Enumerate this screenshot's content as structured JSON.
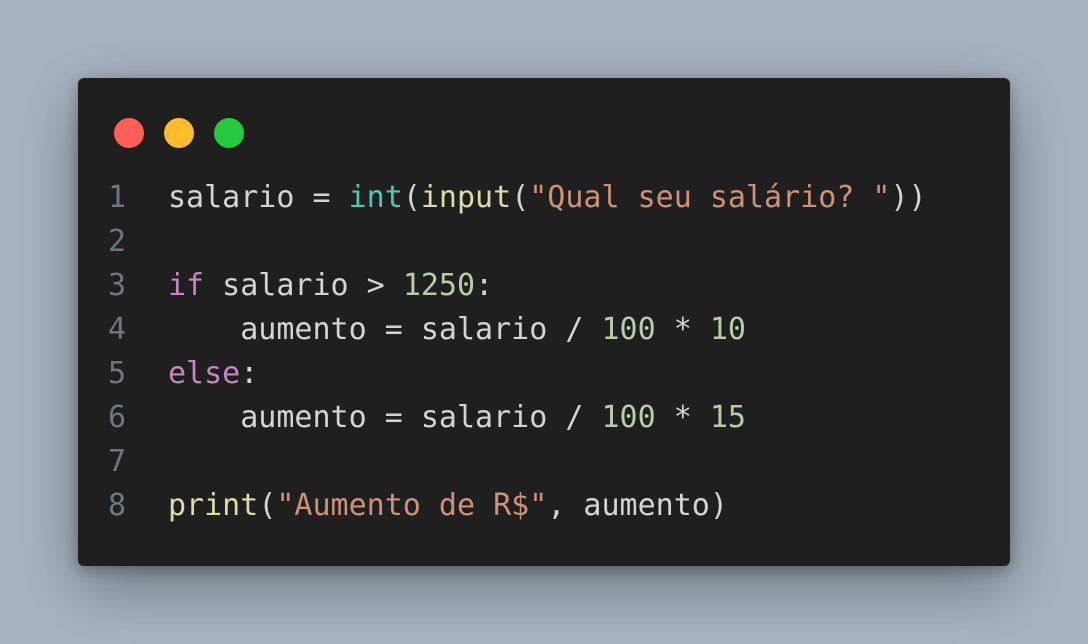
{
  "window": {
    "dots": [
      {
        "name": "close",
        "color": "#ff5f56"
      },
      {
        "name": "minimize",
        "color": "#ffbd2e"
      },
      {
        "name": "maximize",
        "color": "#27c93f"
      }
    ]
  },
  "code": {
    "lines": [
      {
        "n": "1",
        "tokens": [
          {
            "t": "salario",
            "c": "src"
          },
          {
            "t": " = ",
            "c": "op"
          },
          {
            "t": "int",
            "c": "bi"
          },
          {
            "t": "(",
            "c": "op"
          },
          {
            "t": "input",
            "c": "fn"
          },
          {
            "t": "(",
            "c": "op"
          },
          {
            "t": "\"Qual seu salário? \"",
            "c": "str"
          },
          {
            "t": "))",
            "c": "op"
          }
        ]
      },
      {
        "n": "2",
        "tokens": []
      },
      {
        "n": "3",
        "tokens": [
          {
            "t": "if",
            "c": "kw"
          },
          {
            "t": " salario > ",
            "c": "src"
          },
          {
            "t": "1250",
            "c": "num"
          },
          {
            "t": ":",
            "c": "op"
          }
        ]
      },
      {
        "n": "4",
        "tokens": [
          {
            "t": "    aumento = salario / ",
            "c": "src"
          },
          {
            "t": "100",
            "c": "num"
          },
          {
            "t": " * ",
            "c": "op"
          },
          {
            "t": "10",
            "c": "num"
          }
        ]
      },
      {
        "n": "5",
        "tokens": [
          {
            "t": "else",
            "c": "kw"
          },
          {
            "t": ":",
            "c": "op"
          }
        ]
      },
      {
        "n": "6",
        "tokens": [
          {
            "t": "    aumento = salario / ",
            "c": "src"
          },
          {
            "t": "100",
            "c": "num"
          },
          {
            "t": " * ",
            "c": "op"
          },
          {
            "t": "15",
            "c": "num"
          }
        ]
      },
      {
        "n": "7",
        "tokens": []
      },
      {
        "n": "8",
        "tokens": [
          {
            "t": "print",
            "c": "fn"
          },
          {
            "t": "(",
            "c": "op"
          },
          {
            "t": "\"Aumento de R$\"",
            "c": "str"
          },
          {
            "t": ", aumento)",
            "c": "src"
          }
        ]
      }
    ]
  }
}
